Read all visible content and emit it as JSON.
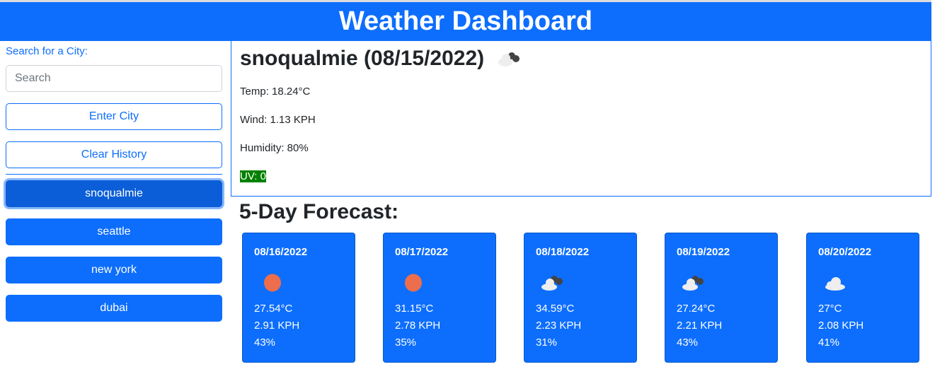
{
  "header": {
    "title": "Weather Dashboard"
  },
  "sidebar": {
    "label": "Search for a City:",
    "search_placeholder": "Search",
    "enter_label": "Enter City",
    "clear_label": "Clear History",
    "history": [
      "snoqualmie",
      "seattle",
      "new york",
      "dubai"
    ],
    "active": "snoqualmie"
  },
  "current": {
    "title": "snoqualmie (08/15/2022)",
    "icon": "cloud-broken-icon",
    "temp": "Temp: 18.24°C",
    "wind": "Wind: 1.13 KPH",
    "humidity": "Humidity: 80%",
    "uv": "UV: 0",
    "uv_color": "#008000"
  },
  "forecast": {
    "heading": "5-Day Forecast:",
    "days": [
      {
        "date": "08/16/2022",
        "icon": "sun",
        "temp": "27.54°C",
        "wind": "2.91 KPH",
        "humidity": "43%"
      },
      {
        "date": "08/17/2022",
        "icon": "sun",
        "temp": "31.15°C",
        "wind": "2.78 KPH",
        "humidity": "35%"
      },
      {
        "date": "08/18/2022",
        "icon": "cloud-broken",
        "temp": "34.59°C",
        "wind": "2.23 KPH",
        "humidity": "31%"
      },
      {
        "date": "08/19/2022",
        "icon": "cloud-broken",
        "temp": "27.24°C",
        "wind": "2.21 KPH",
        "humidity": "43%"
      },
      {
        "date": "08/20/2022",
        "icon": "cloud",
        "temp": "27°C",
        "wind": "2.08 KPH",
        "humidity": "41%"
      }
    ]
  },
  "colors": {
    "primary": "#0d6efd",
    "sun": "#ec6e4c"
  }
}
